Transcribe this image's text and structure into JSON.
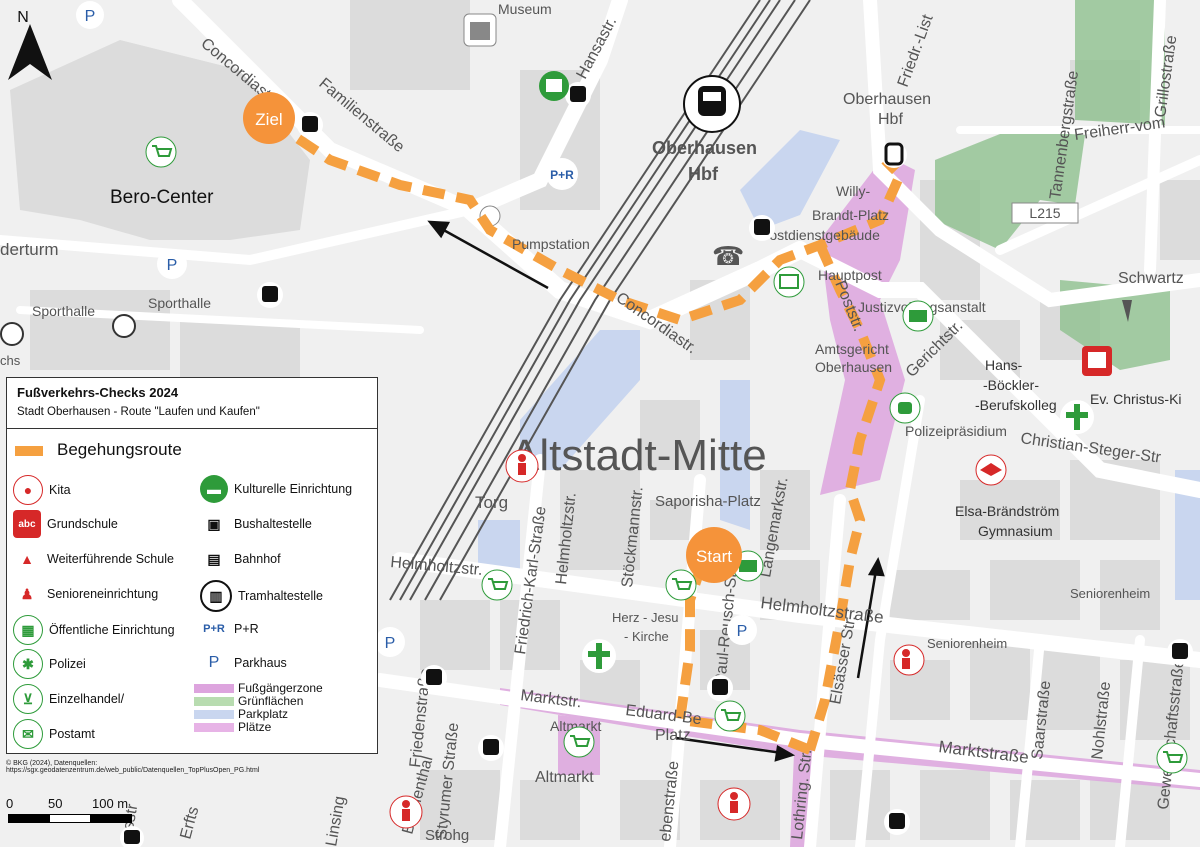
{
  "north": "N",
  "markers": {
    "start": "Start",
    "goal": "Ziel"
  },
  "district": "Altstadt-Mitte",
  "place_labels": {
    "bero_center": "Bero-Center",
    "station_name": "Oberhausen",
    "station_name2": "Hbf",
    "hbf_small": "Oberhausen",
    "hbf_small2": "Hbf",
    "museum": "Museum",
    "pumpstation": "Pumpstation",
    "sporthalle": "Sporthalle",
    "willy_brandt": "Willy-",
    "willy_brandt2": "Brandt-Platz",
    "postdienstgebaeude": "Postdienstgebäude",
    "hauptpost": "Hauptpost",
    "justizvollzugsanstalt": "Justizvollzugsanstalt",
    "amtsgericht": "Amtsgericht",
    "amtsgericht2": "Oberhausen",
    "hans_boeckler": "Hans-",
    "hans_boeckler2": "-Böckler-",
    "hans_boeckler3": "-Berufskolleg",
    "polizeipraesidium": "Polizeipräsidium",
    "ev_christus": "Ev. Christus-Ki",
    "elsa": "Elsa-Brändström",
    "elsa2": "Gymnasium",
    "saporisha": "Saporisha-Platz",
    "herz_jesu": "Herz - Jesu",
    "herz_jesu2": "- Kirche",
    "seniorenheim": "Seniorenheim",
    "seniorenheim2": "Seniorenheim",
    "altmarkt": "Altmarkt",
    "altmarkt2": "Altmarkt",
    "torg": "Torg",
    "sterturm": "derturm",
    "sportball": "chs",
    "strohg": "Strohg",
    "road_number": "L215"
  },
  "street_labels": {
    "concordia_top": "Concordiastraße",
    "familienstrasse": "Familienstraße",
    "hansastrasse": "Hansastr.",
    "friedr_list": "Friedr.-List",
    "tannenbergstrasse": "Tannenbergstraße",
    "grillostrasse": "Grillostraße",
    "freiherr": "Freiherr-vom",
    "schwartz": "Schwartz",
    "concordiastr": "Concordiastr.",
    "poststr": "Poststr.",
    "gerichtstr": "Gerichtstr.",
    "christian_steger": "Christian-Steger-Str",
    "helmholtz_left": "Helmholtzstr.",
    "helmholtzstrasse": "Helmholtzstraße",
    "friedrich_karl": "Friedrich-Karl-Straße",
    "helmholtzstr_v": "Helmholtzstr.",
    "stoeckmannstr": "Stöckmannstr.",
    "paul_reusch": "Paul-Reusch-Str.",
    "langemarkstr": "Langemarkstr.",
    "elsaesser": "Elsässer Str.",
    "marktstr_left": "Marktstr.",
    "eduard": "Eduard-Be",
    "platz": "Platz",
    "marktstrasse": "Marktstraße",
    "friedenstrasse": "Friedenstraße",
    "styrumer": "Styrumer Straße",
    "lothring": "Lothring. Str.",
    "saarstrasse": "Saarstraße",
    "nohlstrasse": "Nohlstraße",
    "gewerkschaft": "Gewerkschaftsstraße",
    "blumenthal": "Blumenthal",
    "erfts": "Erfts",
    "linsing": "Linsing",
    "ebenstrasse": "ebenstraße",
    "ossstr": "ossstr"
  },
  "legend": {
    "title": "Fußverkehrs-Checks 2024",
    "subtitle": "Stadt Oberhausen - Route \"Laufen und Kaufen\"",
    "route_label": "Begehungsroute",
    "left_items": [
      "Kita",
      "Grundschule",
      "Weiterführende Schule",
      "Senioreneinrichtung",
      "Öffentliche Einrichtung",
      "Polizei",
      "Einzelhandel/",
      "Postamt"
    ],
    "right_items": [
      "Kulturelle Einrichtung",
      "Bushaltestelle",
      "Bahnhof",
      "Tramhaltestelle",
      "P+R",
      "Parkhaus"
    ],
    "areas": [
      "Fußgängerzone",
      "Grünflächen",
      "Parkplatz",
      "Plätze"
    ],
    "icon_text": {
      "pr": "P+R",
      "p": "P"
    }
  },
  "credits": {
    "line1": "© BKG (2024), Datenquellen:",
    "line2": "https://sgx.geodatenzentrum.de/web_public/Datenquellen_TopPlusOpen_PG.html"
  },
  "scale": {
    "zero": "0",
    "fifty": "50",
    "hundred": "100 m"
  },
  "colors": {
    "route": "#f5a040",
    "marker": "#f5933a",
    "pedestrian_zone": "#dda4de",
    "green": "#8fc08f",
    "parking": "#c9d6ef",
    "squares": "#e7b3e6",
    "kita": "#d62828",
    "green_icon": "#2e9b3a",
    "pr": "#2a5da8"
  }
}
